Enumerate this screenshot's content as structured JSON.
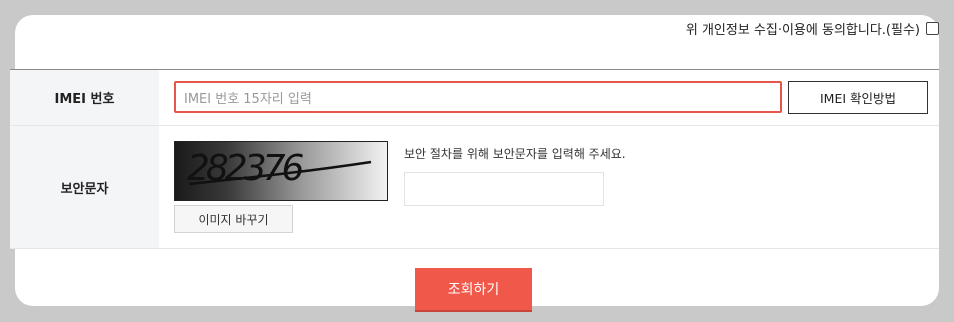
{
  "agreement": {
    "label": "위 개인정보 수집·이용에 동의합니다.(필수)",
    "checked": false
  },
  "imei": {
    "label": "IMEI 번호",
    "placeholder": "IMEI 번호 15자리 입력",
    "help_button": "IMEI 확인방법"
  },
  "captcha": {
    "label": "보안문자",
    "image_text": "282376",
    "change_button": "이미지 바꾸기",
    "instruction": "보안 절차를 위해 보안문자를 입력해 주세요.",
    "input_value": ""
  },
  "submit": {
    "label": "조회하기"
  },
  "colors": {
    "accent": "#f0584a",
    "input_border_active": "#e8554a",
    "label_bg": "#f4f5f7"
  }
}
